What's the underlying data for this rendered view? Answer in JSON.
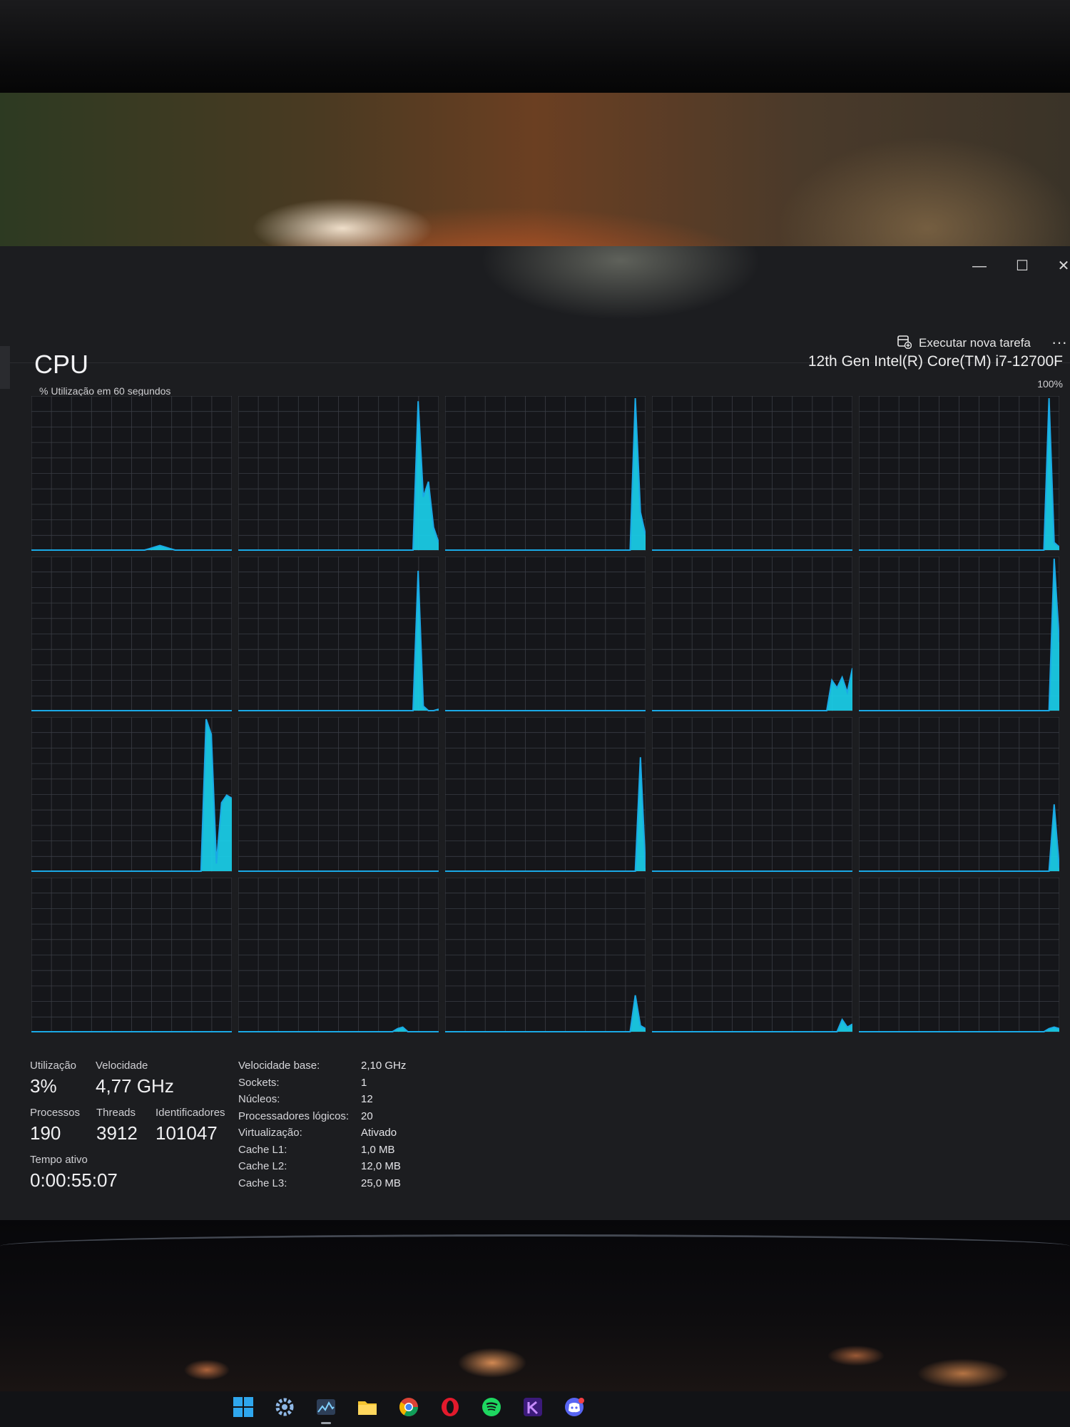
{
  "window": {
    "minimize": "—",
    "maximize": "☐",
    "close": "✕"
  },
  "toolbar": {
    "run_new_task": "Executar nova tarefa",
    "more": "···"
  },
  "cpu": {
    "title": "CPU",
    "model": "12th Gen Intel(R) Core(TM) i7-12700F",
    "util_label": "% Utilização em 60 segundos",
    "max_label": "100%"
  },
  "stats": {
    "utilization_label": "Utilização",
    "utilization_value": "3%",
    "speed_label": "Velocidade",
    "speed_value": "4,77 GHz",
    "processes_label": "Processos",
    "processes_value": "190",
    "threads_label": "Threads",
    "threads_value": "3912",
    "handles_label": "Identificadores",
    "handles_value": "101047",
    "uptime_label": "Tempo ativo",
    "uptime_value": "0:00:55:07"
  },
  "details": [
    {
      "key": "Velocidade base:",
      "value": "2,10 GHz"
    },
    {
      "key": "Sockets:",
      "value": "1"
    },
    {
      "key": "Núcleos:",
      "value": "12"
    },
    {
      "key": "Processadores lógicos:",
      "value": "20"
    },
    {
      "key": "Virtualização:",
      "value": "Ativado"
    },
    {
      "key": "Cache L1:",
      "value": "1,0 MB"
    },
    {
      "key": "Cache L2:",
      "value": "12,0 MB"
    },
    {
      "key": "Cache L3:",
      "value": "25,0 MB"
    }
  ],
  "colors": {
    "graph_line": "#1aa9e6",
    "graph_fill": "#19d3ee",
    "grid": "#3a3d44",
    "graph_bg": "#15161a"
  },
  "logical_processor_usage": [
    [
      0,
      0,
      0,
      0,
      0,
      0,
      0,
      0,
      0,
      0,
      0,
      0,
      0,
      0,
      0,
      0,
      0,
      0,
      0,
      0,
      0,
      0,
      0,
      1,
      2,
      3,
      2,
      1,
      0,
      0,
      0,
      0,
      0,
      0,
      0,
      0,
      0,
      0,
      0,
      0
    ],
    [
      0,
      0,
      0,
      0,
      0,
      0,
      0,
      0,
      0,
      0,
      0,
      0,
      0,
      0,
      0,
      0,
      0,
      0,
      0,
      0,
      0,
      0,
      0,
      0,
      0,
      0,
      0,
      0,
      0,
      0,
      0,
      0,
      0,
      0,
      0,
      98,
      35,
      45,
      15,
      5
    ],
    [
      0,
      0,
      0,
      0,
      0,
      0,
      0,
      0,
      0,
      0,
      0,
      0,
      0,
      0,
      0,
      0,
      0,
      0,
      0,
      0,
      0,
      0,
      0,
      0,
      0,
      0,
      0,
      0,
      0,
      0,
      0,
      0,
      0,
      0,
      0,
      0,
      0,
      100,
      25,
      10
    ],
    [
      0,
      0,
      0,
      0,
      0,
      0,
      0,
      0,
      0,
      0,
      0,
      0,
      0,
      0,
      0,
      0,
      0,
      0,
      0,
      0,
      0,
      0,
      0,
      0,
      0,
      0,
      0,
      0,
      0,
      0,
      0,
      0,
      0,
      0,
      0,
      0,
      0,
      0,
      0,
      0
    ],
    [
      0,
      0,
      0,
      0,
      0,
      0,
      0,
      0,
      0,
      0,
      0,
      0,
      0,
      0,
      0,
      0,
      0,
      0,
      0,
      0,
      0,
      0,
      0,
      0,
      0,
      0,
      0,
      0,
      0,
      0,
      0,
      0,
      0,
      0,
      0,
      0,
      0,
      100,
      5,
      2
    ],
    [
      0,
      0,
      0,
      0,
      0,
      0,
      0,
      0,
      0,
      0,
      0,
      0,
      0,
      0,
      0,
      0,
      0,
      0,
      0,
      0,
      0,
      0,
      0,
      0,
      0,
      0,
      0,
      0,
      0,
      0,
      0,
      0,
      0,
      0,
      0,
      0,
      0,
      0,
      0,
      0
    ],
    [
      0,
      0,
      0,
      0,
      0,
      0,
      0,
      0,
      0,
      0,
      0,
      0,
      0,
      0,
      0,
      0,
      0,
      0,
      0,
      0,
      0,
      0,
      0,
      0,
      0,
      0,
      0,
      0,
      0,
      0,
      0,
      0,
      0,
      0,
      0,
      92,
      3,
      0,
      0,
      1
    ],
    [
      0,
      0,
      0,
      0,
      0,
      0,
      0,
      0,
      0,
      0,
      0,
      0,
      0,
      0,
      0,
      0,
      0,
      0,
      0,
      0,
      0,
      0,
      0,
      0,
      0,
      0,
      0,
      0,
      0,
      0,
      0,
      0,
      0,
      0,
      0,
      0,
      0,
      0,
      0,
      0
    ],
    [
      0,
      0,
      0,
      0,
      0,
      0,
      0,
      0,
      0,
      0,
      0,
      0,
      0,
      0,
      0,
      0,
      0,
      0,
      0,
      0,
      0,
      0,
      0,
      0,
      0,
      0,
      0,
      0,
      0,
      0,
      0,
      0,
      0,
      0,
      0,
      20,
      15,
      22,
      12,
      28
    ],
    [
      0,
      0,
      0,
      0,
      0,
      0,
      0,
      0,
      0,
      0,
      0,
      0,
      0,
      0,
      0,
      0,
      0,
      0,
      0,
      0,
      0,
      0,
      0,
      0,
      0,
      0,
      0,
      0,
      0,
      0,
      0,
      0,
      0,
      0,
      0,
      0,
      0,
      0,
      100,
      45
    ],
    [
      0,
      0,
      0,
      0,
      0,
      0,
      0,
      0,
      0,
      0,
      0,
      0,
      0,
      0,
      0,
      0,
      0,
      0,
      0,
      0,
      0,
      0,
      0,
      0,
      0,
      0,
      0,
      0,
      0,
      0,
      0,
      0,
      0,
      0,
      100,
      90,
      5,
      45,
      50,
      48
    ],
    [
      0,
      0,
      0,
      0,
      0,
      0,
      0,
      0,
      0,
      0,
      0,
      0,
      0,
      0,
      0,
      0,
      0,
      0,
      0,
      0,
      0,
      0,
      0,
      0,
      0,
      0,
      0,
      0,
      0,
      0,
      0,
      0,
      0,
      0,
      0,
      0,
      0,
      0,
      0,
      0
    ],
    [
      0,
      0,
      0,
      0,
      0,
      0,
      0,
      0,
      0,
      0,
      0,
      0,
      0,
      0,
      0,
      0,
      0,
      0,
      0,
      0,
      0,
      0,
      0,
      0,
      0,
      0,
      0,
      0,
      0,
      0,
      0,
      0,
      0,
      0,
      0,
      0,
      0,
      0,
      75,
      2
    ],
    [
      0,
      0,
      0,
      0,
      0,
      0,
      0,
      0,
      0,
      0,
      0,
      0,
      0,
      0,
      0,
      0,
      0,
      0,
      0,
      0,
      0,
      0,
      0,
      0,
      0,
      0,
      0,
      0,
      0,
      0,
      0,
      0,
      0,
      0,
      0,
      0,
      0,
      0,
      0,
      0
    ],
    [
      0,
      0,
      0,
      0,
      0,
      0,
      0,
      0,
      0,
      0,
      0,
      0,
      0,
      0,
      0,
      0,
      0,
      0,
      0,
      0,
      0,
      0,
      0,
      0,
      0,
      0,
      0,
      0,
      0,
      0,
      0,
      0,
      0,
      0,
      0,
      0,
      0,
      0,
      44,
      2
    ],
    [
      0,
      0,
      0,
      0,
      0,
      0,
      0,
      0,
      0,
      0,
      0,
      0,
      0,
      0,
      0,
      0,
      0,
      0,
      0,
      0,
      0,
      0,
      0,
      0,
      0,
      0,
      0,
      0,
      0,
      0,
      0,
      0,
      0,
      0,
      0,
      0,
      0,
      0,
      0,
      0
    ],
    [
      0,
      0,
      0,
      0,
      0,
      0,
      0,
      0,
      0,
      0,
      0,
      0,
      0,
      0,
      0,
      0,
      0,
      0,
      0,
      0,
      0,
      0,
      0,
      0,
      0,
      0,
      0,
      0,
      0,
      0,
      0,
      2,
      3,
      0,
      0,
      0,
      0,
      0,
      0,
      0
    ],
    [
      0,
      0,
      0,
      0,
      0,
      0,
      0,
      0,
      0,
      0,
      0,
      0,
      0,
      0,
      0,
      0,
      0,
      0,
      0,
      0,
      0,
      0,
      0,
      0,
      0,
      0,
      0,
      0,
      0,
      0,
      0,
      0,
      0,
      0,
      0,
      0,
      0,
      24,
      4,
      2
    ],
    [
      0,
      0,
      0,
      0,
      0,
      0,
      0,
      0,
      0,
      0,
      0,
      0,
      0,
      0,
      0,
      0,
      0,
      0,
      0,
      0,
      0,
      0,
      0,
      0,
      0,
      0,
      0,
      0,
      0,
      0,
      0,
      0,
      0,
      0,
      0,
      0,
      0,
      8,
      3,
      5
    ],
    [
      0,
      0,
      0,
      0,
      0,
      0,
      0,
      0,
      0,
      0,
      0,
      0,
      0,
      0,
      0,
      0,
      0,
      0,
      0,
      0,
      0,
      0,
      0,
      0,
      0,
      0,
      0,
      0,
      0,
      0,
      0,
      0,
      0,
      0,
      0,
      0,
      0,
      2,
      3,
      2
    ]
  ],
  "taskbar": [
    {
      "name": "start-icon"
    },
    {
      "name": "settings-icon"
    },
    {
      "name": "task-manager-icon",
      "active": true
    },
    {
      "name": "file-explorer-icon"
    },
    {
      "name": "chrome-icon"
    },
    {
      "name": "opera-icon"
    },
    {
      "name": "spotify-icon"
    },
    {
      "name": "app-k-icon"
    },
    {
      "name": "discord-icon"
    }
  ]
}
